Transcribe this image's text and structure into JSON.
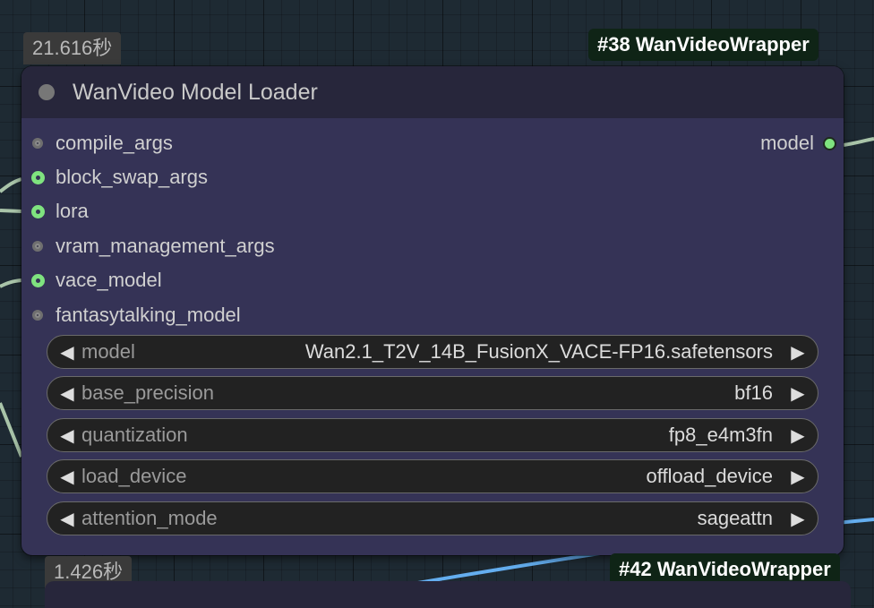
{
  "timing": {
    "top": "21.616秒",
    "bottom": "1.426秒"
  },
  "tags": {
    "top": "#38 WanVideoWrapper",
    "bottom": "#42 WanVideoWrapper"
  },
  "node": {
    "title": "WanVideo Model Loader",
    "inputs": [
      {
        "label": "compile_args",
        "connected": false
      },
      {
        "label": "block_swap_args",
        "connected": true
      },
      {
        "label": "lora",
        "connected": true
      },
      {
        "label": "vram_management_args",
        "connected": false
      },
      {
        "label": "vace_model",
        "connected": true
      },
      {
        "label": "fantasytalking_model",
        "connected": false
      }
    ],
    "output": {
      "label": "model"
    },
    "widgets": [
      {
        "label": "model",
        "value": "Wan2.1_T2V_14B_FusionX_VACE-FP16.safetensors"
      },
      {
        "label": "base_precision",
        "value": "bf16"
      },
      {
        "label": "quantization",
        "value": "fp8_e4m3fn"
      },
      {
        "label": "load_device",
        "value": "offload_device"
      },
      {
        "label": "attention_mode",
        "value": "sageattn"
      }
    ]
  },
  "icons": {
    "arrow_left": "◀",
    "arrow_right": "▶"
  },
  "colors": {
    "node_body": "#353356",
    "node_header": "#27263b",
    "connected_slot": "#7fe37f",
    "link_green": "#a9c4a9",
    "link_blue": "#64aef0"
  }
}
